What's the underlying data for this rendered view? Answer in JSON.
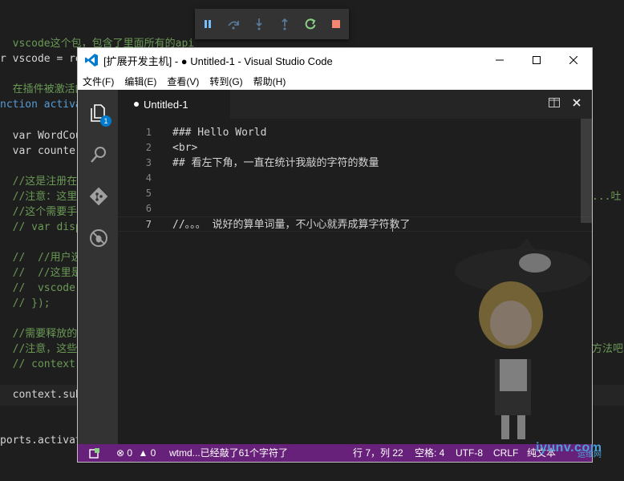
{
  "background_editor": {
    "lines_left": [
      {
        "text": "  vscode这个包，包含了里面所有的api",
        "class": "c-comment"
      },
      {
        "text": "r vscode = re",
        "class": "c-plain"
      },
      {
        "text": "  在插件被激活的",
        "class": "c-comment"
      },
      {
        "text": "nction activa",
        "class": "c-keyword"
      },
      {
        "text": "  var WordCou",
        "class": "c-plain"
      },
      {
        "text": "  var counter",
        "class": "c-plain"
      },
      {
        "text": "  //这是注册在",
        "class": "c-comment"
      },
      {
        "text": "  //注意：这里",
        "class": "c-comment"
      },
      {
        "text": "  //这个需要手",
        "class": "c-comment"
      },
      {
        "text": "  // var disp",
        "class": "c-comment"
      },
      {
        "text": "  //  //用户选",
        "class": "c-comment"
      },
      {
        "text": "  //  //这里是",
        "class": "c-comment"
      },
      {
        "text": "  //  vscode.",
        "class": "c-comment"
      },
      {
        "text": "  // });",
        "class": "c-comment"
      },
      {
        "text": "  //需要释放的",
        "class": "c-comment"
      },
      {
        "text": "  //注意，这些",
        "class": "c-comment"
      },
      {
        "text": "  // context.",
        "class": "c-comment"
      },
      {
        "text": "  context.sub",
        "class": "c-plain"
      },
      {
        "text": "ports.activat",
        "class": "c-plain"
      }
    ],
    "lines_right": [
      {
        "text": "...吐",
        "class": "c-comment"
      },
      {
        "text": "方法吧",
        "class": "c-comment"
      }
    ]
  },
  "debug_toolbar": {
    "buttons": [
      {
        "name": "pause-button",
        "icon": "pause-icon",
        "color": "#75beff"
      },
      {
        "name": "step-over-button",
        "icon": "step-over-icon",
        "color": "#75beff"
      },
      {
        "name": "step-into-button",
        "icon": "step-into-icon",
        "color": "#75beff"
      },
      {
        "name": "step-out-button",
        "icon": "step-out-icon",
        "color": "#75beff"
      },
      {
        "name": "restart-button",
        "icon": "restart-icon",
        "color": "#89d185"
      },
      {
        "name": "stop-button",
        "icon": "stop-icon",
        "color": "#f48771"
      }
    ]
  },
  "window": {
    "title": "[扩展开发主机] - ● Untitled-1 - Visual Studio Code",
    "menu": [
      "文件(F)",
      "编辑(E)",
      "查看(V)",
      "转到(G)",
      "帮助(H)"
    ]
  },
  "activity_bar": {
    "explorer_badge": "1"
  },
  "editor": {
    "tab_label": "Untitled-1",
    "lines": [
      {
        "number": "1",
        "text": "### Hello World"
      },
      {
        "number": "2",
        "text": "<br>"
      },
      {
        "number": "3",
        "text": "## 看左下角，一直在统计我敲的字符的数量"
      },
      {
        "number": "4",
        "text": ""
      },
      {
        "number": "5",
        "text": ""
      },
      {
        "number": "6",
        "text": ""
      },
      {
        "number": "7",
        "text": "//。。。 说好的算单词量，不小心就弄成算字符数了"
      }
    ]
  },
  "statusbar": {
    "errors": "0",
    "warnings": "0",
    "message": "wtmd...已经敲了61个字符了",
    "position": "行 7，列 22",
    "indent": "空格: 4",
    "encoding": "UTF-8",
    "eol": "CRLF",
    "language": "纯文本"
  },
  "watermark": {
    "text": "iyunv.com",
    "sub": "运维网"
  },
  "colors": {
    "statusbar_bg": "#68217a",
    "activitybar_bg": "#333333",
    "editor_bg": "#1e1e1e",
    "accent": "#007acc"
  }
}
